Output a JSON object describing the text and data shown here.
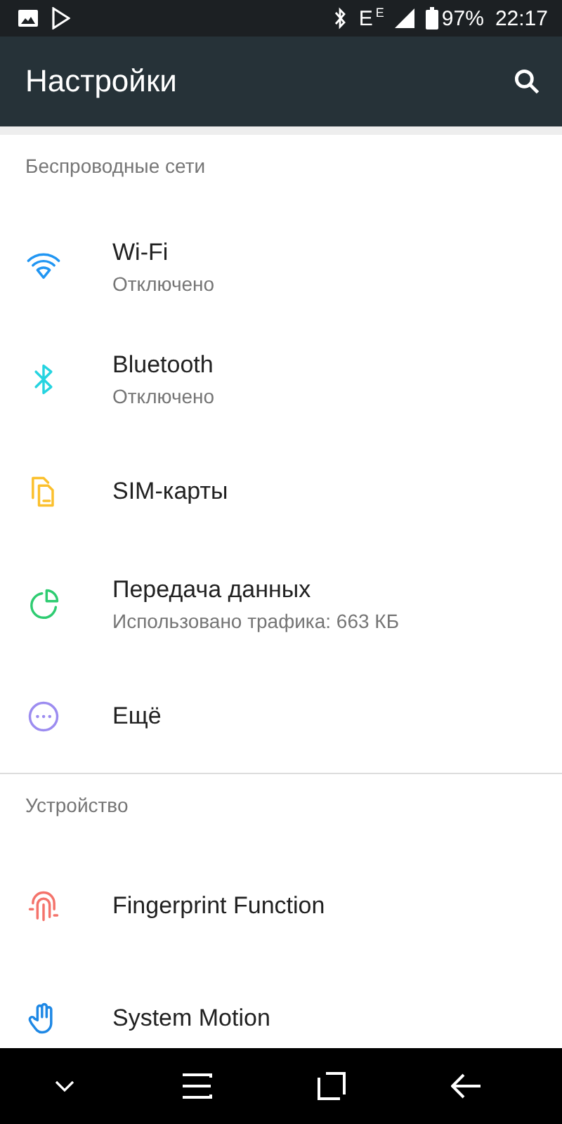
{
  "status_bar": {
    "network": "E",
    "network_sup": "E",
    "battery": "97%",
    "time": "22:17"
  },
  "toolbar": {
    "title": "Настройки"
  },
  "sections": [
    {
      "title": "Беспроводные сети",
      "items": [
        {
          "kind": "wifi",
          "color": "#2196f3",
          "title": "Wi-Fi",
          "summary": "Отключено"
        },
        {
          "kind": "bluetooth",
          "color": "#26d4e0",
          "title": "Bluetooth",
          "summary": "Отключено"
        },
        {
          "kind": "sim",
          "color": "#fbc02d",
          "title": "SIM-карты"
        },
        {
          "kind": "data",
          "color": "#2ecc71",
          "title": "Передача данных",
          "summary": "Использовано трафика: 663 КБ"
        },
        {
          "kind": "more",
          "color": "#9c8cf0",
          "title": "Ещё"
        }
      ]
    },
    {
      "title": "Устройство",
      "items": [
        {
          "kind": "fingerprint",
          "color": "#f4736b",
          "title": "Fingerprint Function"
        },
        {
          "kind": "motion",
          "color": "#1e88e5",
          "title": "System Motion"
        }
      ]
    }
  ]
}
